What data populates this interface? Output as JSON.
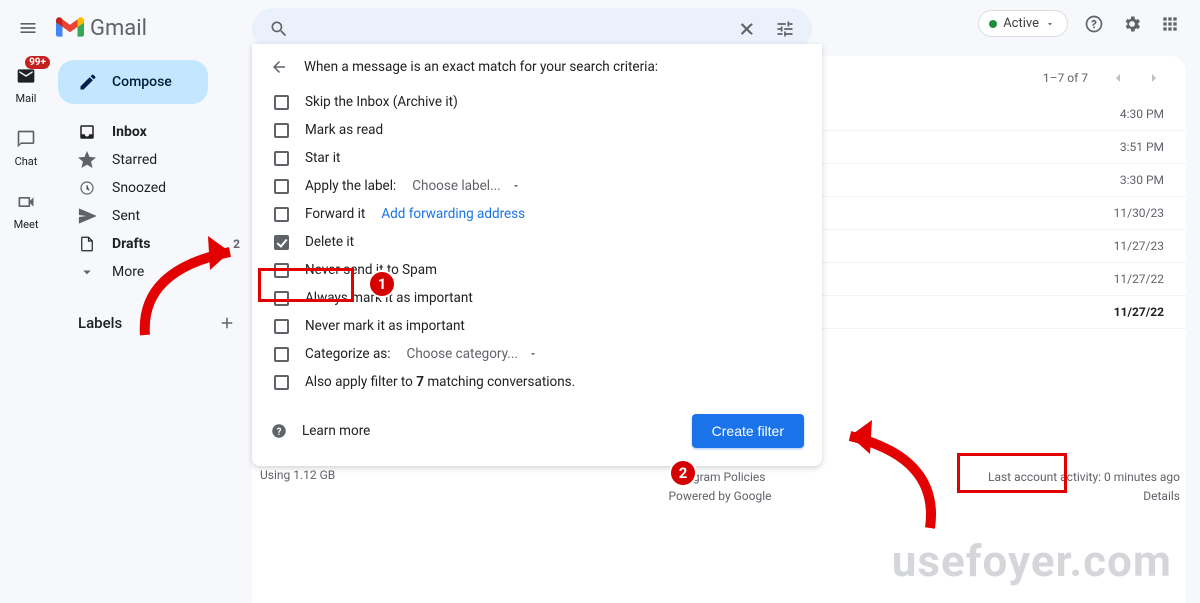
{
  "header": {
    "app_name": "Gmail",
    "status": "Active",
    "search_placeholder": ""
  },
  "rail": {
    "mail": "Mail",
    "chat": "Chat",
    "meet": "Meet",
    "badge": "99+"
  },
  "nav": {
    "compose": "Compose",
    "items": [
      {
        "label": "Inbox",
        "bold": true,
        "icon": "inbox"
      },
      {
        "label": "Starred",
        "icon": "star"
      },
      {
        "label": "Snoozed",
        "icon": "clock"
      },
      {
        "label": "Sent",
        "icon": "send"
      },
      {
        "label": "Drafts",
        "bold": true,
        "icon": "file",
        "count": "2"
      },
      {
        "label": "More",
        "icon": "chev"
      }
    ],
    "labels_header": "Labels"
  },
  "list": {
    "count": "1–7 of 7",
    "rows": [
      {
        "time": "4:30 PM"
      },
      {
        "time": "3:51 PM"
      },
      {
        "time": "3:30 PM"
      },
      {
        "time": "11/30/23"
      },
      {
        "time": "11/27/23"
      },
      {
        "time": "11/27/22"
      },
      {
        "time": "11/27/22",
        "bold": true
      }
    ]
  },
  "panel": {
    "title": "When a message is an exact match for your search criteria:",
    "options": {
      "skip_inbox": "Skip the Inbox (Archive it)",
      "mark_read": "Mark as read",
      "star_it": "Star it",
      "apply_label": "Apply the label:",
      "choose_label": "Choose label...",
      "forward_it": "Forward it",
      "add_fwd": "Add forwarding address",
      "delete_it": "Delete it",
      "never_spam": "Never send it to Spam",
      "always_important": "Always mark it as important",
      "never_important": "Never mark it as important",
      "categorize": "Categorize as:",
      "choose_category": "Choose category...",
      "also_apply_pre": "Also apply filter to ",
      "also_apply_count": "7",
      "also_apply_post": " matching conversations."
    },
    "learn_more": "Learn more",
    "create_filter": "Create filter"
  },
  "footer": {
    "storage": "Using 1.12 GB",
    "policies": "Program Policies",
    "powered": "Powered by Google",
    "activity": "Last account activity: 0 minutes ago",
    "details": "Details"
  },
  "watermark": "usefoyer.com"
}
